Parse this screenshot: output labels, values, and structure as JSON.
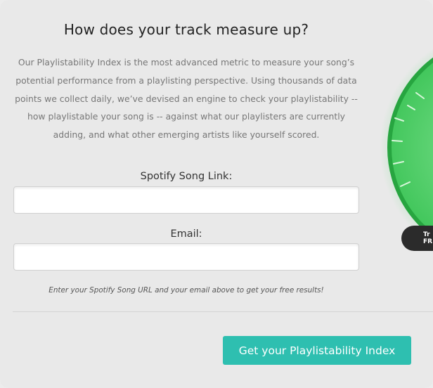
{
  "form": {
    "title": "How does your track measure up?",
    "description": "Our Playlistability Index is the most advanced metric to measure your song’s potential performance from a playlisting perspective. Using thousands of data points we collect daily, we’ve devised an engine to check your playlistability -- how playlistable your song is -- against what our playlisters are currently adding, and what other emerging artists like yourself scored.",
    "song_link_label": "Spotify Song Link:",
    "song_link_value": "",
    "email_label": "Email:",
    "email_value": "",
    "note": "Enter your Spotify Song URL and your email above to get your free results!",
    "submit_label": "Get your Playlistability Index"
  },
  "badge": {
    "line1": "Tr",
    "line2": "FR"
  },
  "colors": {
    "accent": "#2ebfb0",
    "gauge_green": "#3ccf5a",
    "badge_bg": "#2b2b2b"
  }
}
